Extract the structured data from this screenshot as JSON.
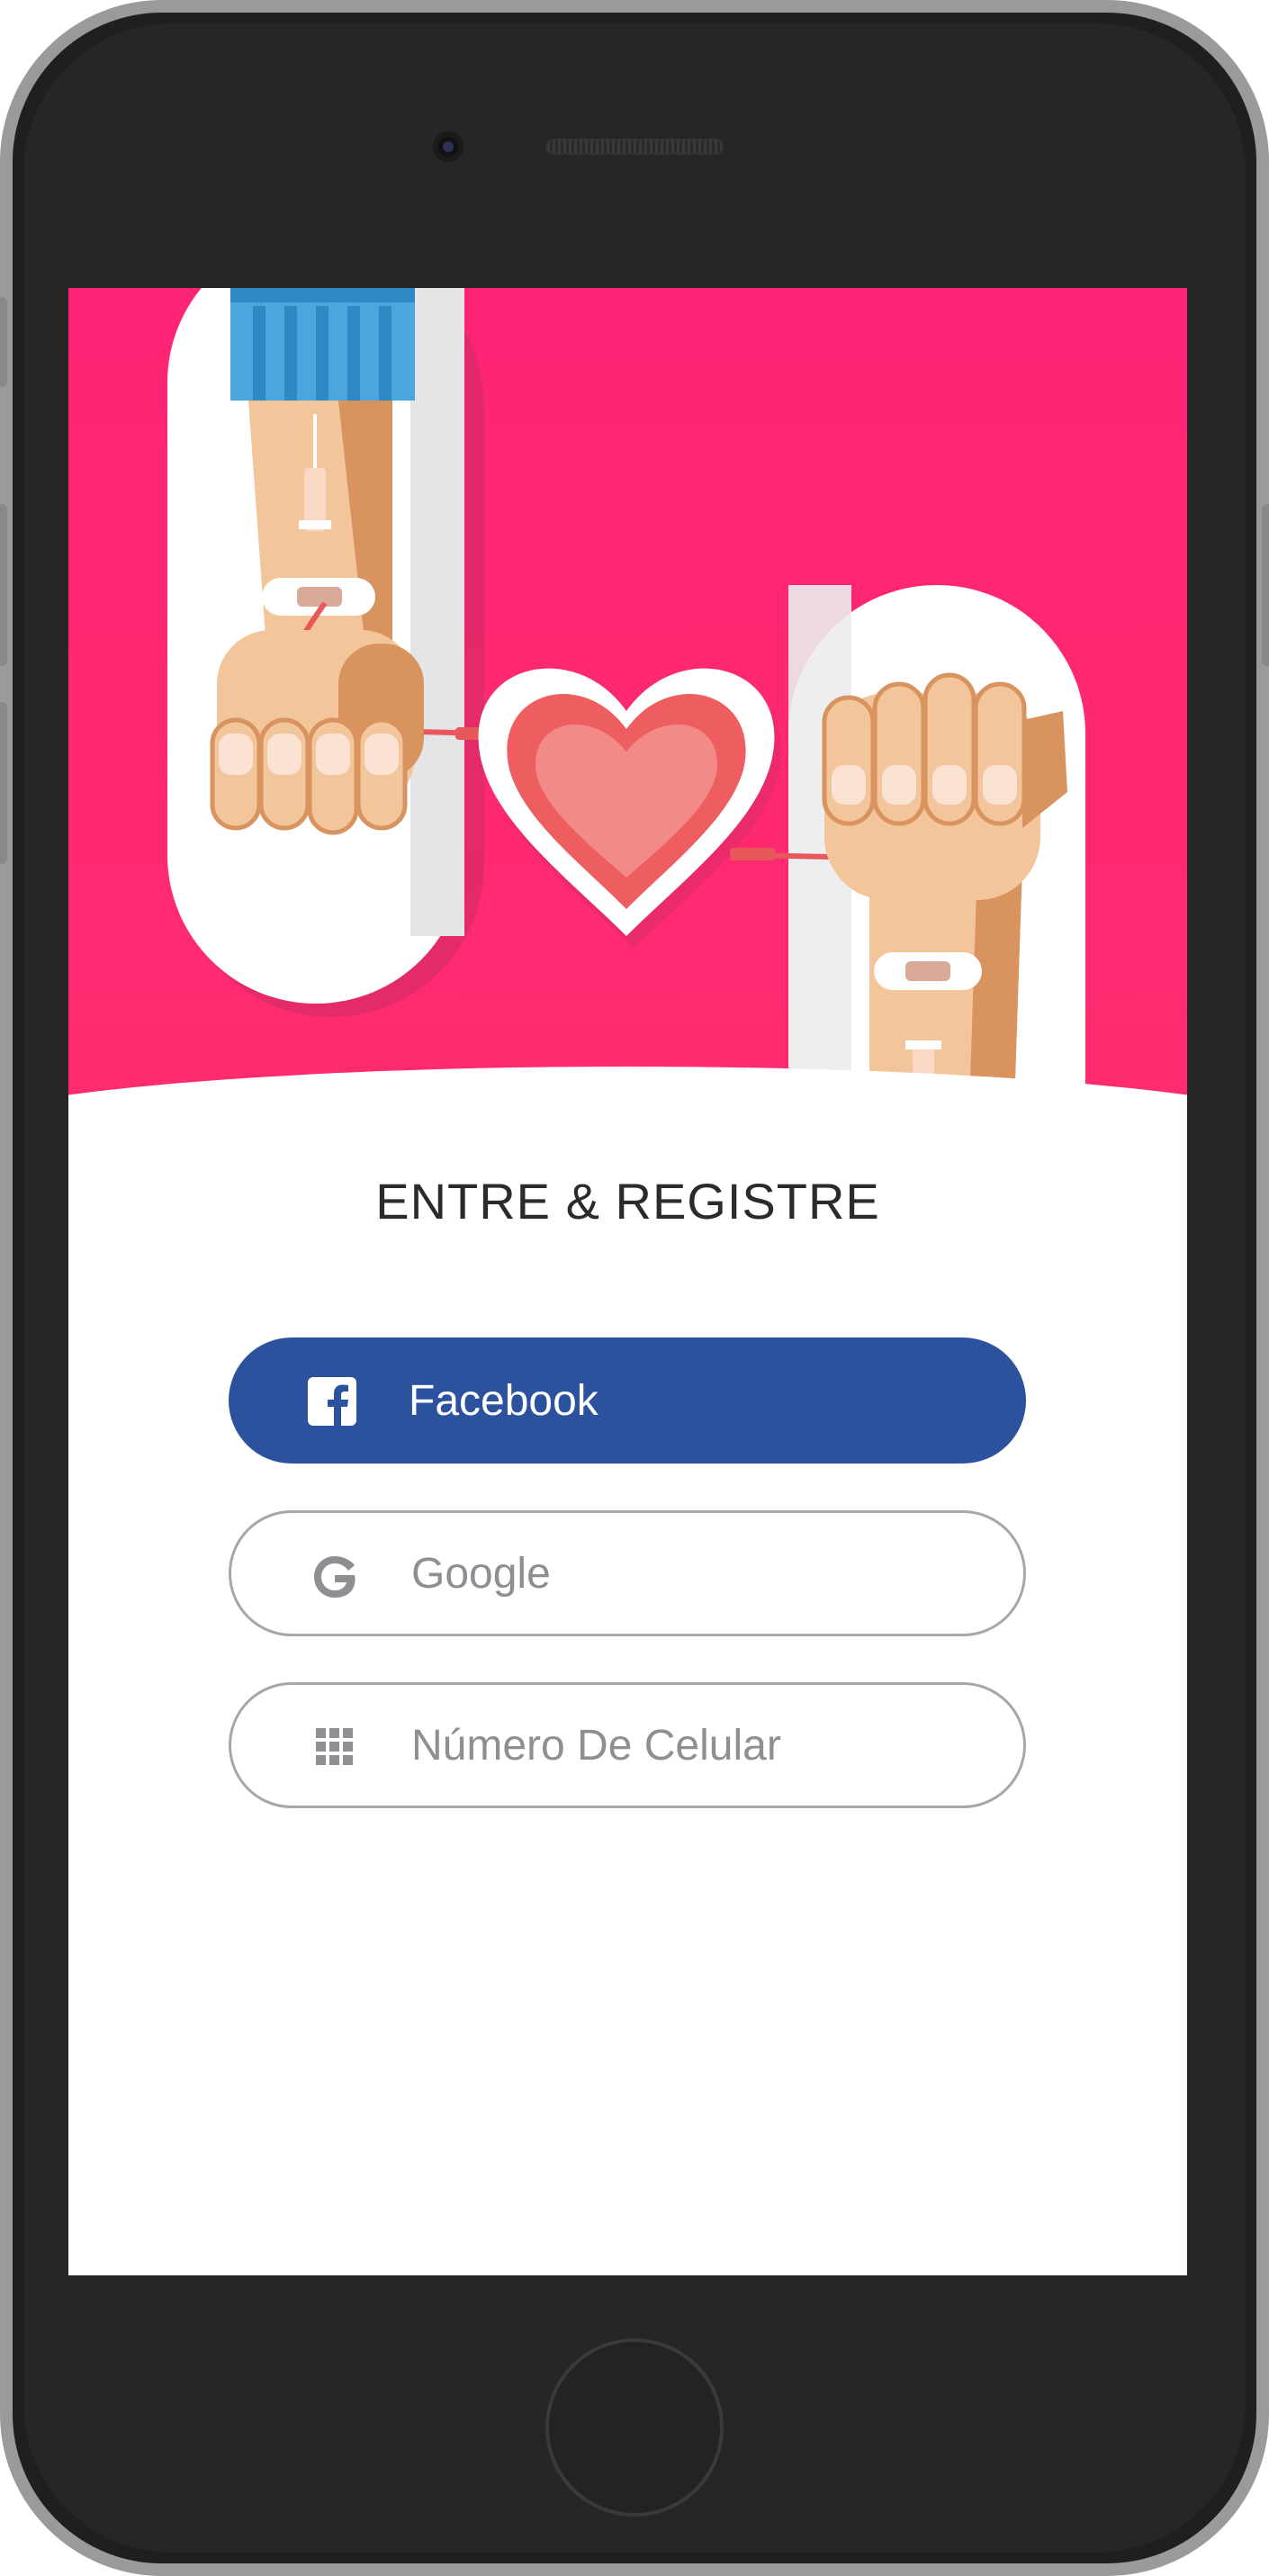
{
  "screen": {
    "title": "ENTRE & REGISTRE"
  },
  "login_options": [
    {
      "label": "Facebook",
      "icon": "facebook-icon"
    },
    {
      "label": "Google",
      "icon": "google-icon"
    },
    {
      "label": "Número De Celular",
      "icon": "keypad-icon"
    }
  ],
  "colors": {
    "hero_background": "#ff2476",
    "facebook_blue": "#2c529e",
    "outline_gray": "#a7a7ab",
    "heart": "#f0595f"
  },
  "illustration": {
    "subject": "blood-donation-hands-heart"
  }
}
